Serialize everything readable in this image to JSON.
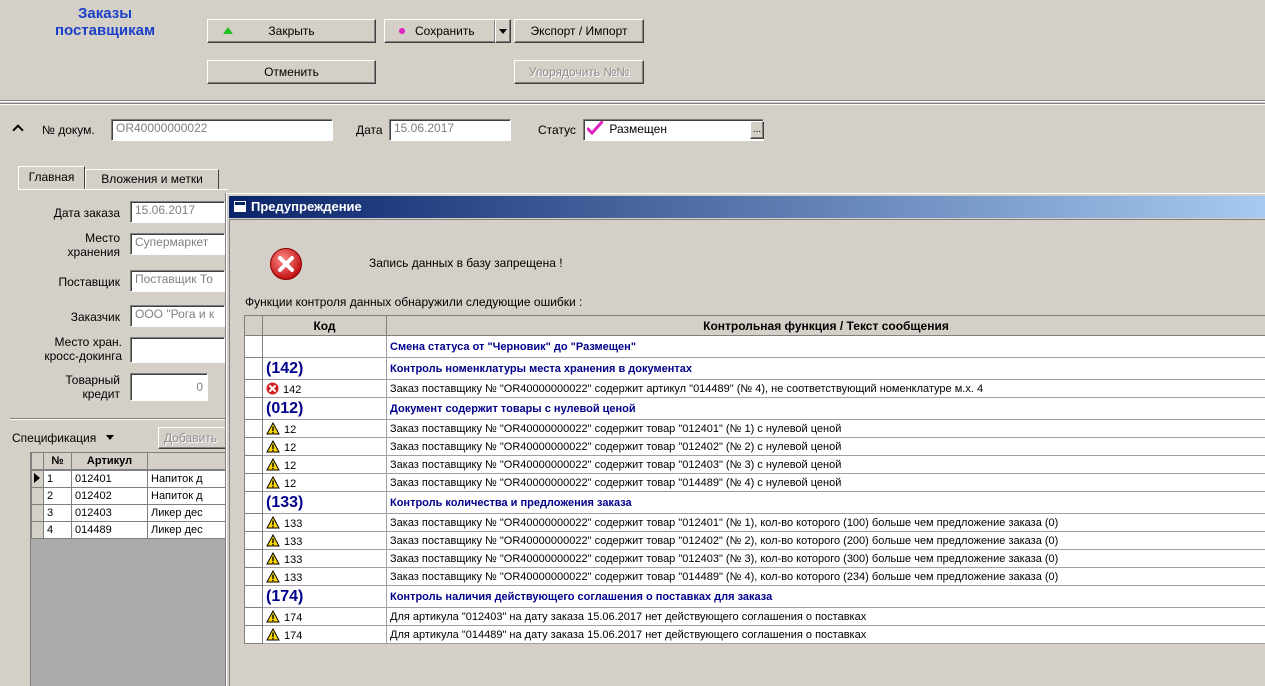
{
  "app": {
    "title_line1": "Заказы",
    "title_line2": "поставщикам"
  },
  "toolbar": {
    "close_label": "Закрыть",
    "save_label": "Сохранить",
    "export_import_label": "Экспорт / Импорт",
    "cancel_label": "Отменить",
    "order_numbers_label": "Упорядочить №№"
  },
  "header": {
    "doc_number_label": "№ докум.",
    "doc_number_value": "OR40000000022",
    "date_label": "Дата",
    "date_value": "15.06.2017",
    "status_label": "Статус",
    "status_value": "Размещен",
    "status_button": "..."
  },
  "tabs": [
    {
      "label": "Главная"
    },
    {
      "label": "Вложения и метки"
    }
  ],
  "form": {
    "order_date_label": "Дата заказа",
    "order_date_value": "15.06.2017",
    "storage_label_1": "Место",
    "storage_label_2": "хранения",
    "storage_value": "Супермаркет",
    "supplier_label": "Поставщик",
    "supplier_value": "Поставщик То",
    "customer_label": "Заказчик",
    "customer_value": "ООО \"Рога и к",
    "crossdock_label_1": "Место хран.",
    "crossdock_label_2": "кросс-докинга",
    "crossdock_value": "",
    "credit_label_1": "Товарный",
    "credit_label_2": "кредит",
    "credit_value": "0"
  },
  "spec": {
    "dropdown_label": "Спецификация",
    "add_label": "Добавить",
    "columns": [
      "№",
      "Артикул",
      ""
    ],
    "rows": [
      {
        "n": "1",
        "article": "012401",
        "name": "Напиток д"
      },
      {
        "n": "2",
        "article": "012402",
        "name": "Напиток д"
      },
      {
        "n": "3",
        "article": "012403",
        "name": "Ликер дес"
      },
      {
        "n": "4",
        "article": "014489",
        "name": "Ликер дес"
      }
    ]
  },
  "dialog": {
    "title": "Предупреждение",
    "main_message": "Запись данных в базу запрещена !",
    "sub_message": "Функции контроля данных обнаружили следующие ошибки :",
    "col_code": "Код",
    "col_text": "Контрольная функция / Текст сообщения",
    "rows": [
      {
        "kind": "group",
        "code": "",
        "text": "Смена статуса от \"Черновик\" до \"Размещен\""
      },
      {
        "kind": "group",
        "code": "(142)",
        "text": "Контроль номенклатуры места хранения в документах"
      },
      {
        "kind": "error",
        "code": "142",
        "text": "Заказ поставщику № \"OR40000000022\" содержит артикул \"014489\" (№ 4), не соответствующий номенклатуре м.х. 4"
      },
      {
        "kind": "group",
        "code": "(012)",
        "text": "Документ содержит товары с нулевой ценой"
      },
      {
        "kind": "warn",
        "code": "12",
        "text": "Заказ поставщику № \"OR40000000022\" содержит товар \"012401\" (№ 1) с нулевой ценой"
      },
      {
        "kind": "warn",
        "code": "12",
        "text": "Заказ поставщику № \"OR40000000022\" содержит товар \"012402\" (№ 2) с нулевой ценой"
      },
      {
        "kind": "warn",
        "code": "12",
        "text": "Заказ поставщику № \"OR40000000022\" содержит товар \"012403\" (№ 3) с нулевой ценой"
      },
      {
        "kind": "warn",
        "code": "12",
        "text": "Заказ поставщику № \"OR40000000022\" содержит товар \"014489\" (№ 4) с нулевой ценой"
      },
      {
        "kind": "group",
        "code": "(133)",
        "text": "Контроль количества и предложения заказа"
      },
      {
        "kind": "warn",
        "code": "133",
        "text": "Заказ поставщику № \"OR40000000022\" содержит товар \"012401\" (№ 1), кол-во которого (100) больше чем предложение заказа (0)"
      },
      {
        "kind": "warn",
        "code": "133",
        "text": "Заказ поставщику № \"OR40000000022\" содержит товар \"012402\" (№ 2), кол-во которого (200) больше чем предложение заказа (0)"
      },
      {
        "kind": "warn",
        "code": "133",
        "text": "Заказ поставщику № \"OR40000000022\" содержит товар \"012403\" (№ 3), кол-во которого (300) больше чем предложение заказа (0)"
      },
      {
        "kind": "warn",
        "code": "133",
        "text": "Заказ поставщику № \"OR40000000022\" содержит товар \"014489\" (№ 4), кол-во которого (234) больше чем предложение заказа (0)"
      },
      {
        "kind": "group",
        "code": "(174)",
        "text": "Контроль наличия действующего соглашения о поставках для заказа"
      },
      {
        "kind": "warn",
        "code": "174",
        "text": "Для артикула \"012403\" на дату заказа 15.06.2017 нет действующего соглашения о поставках"
      },
      {
        "kind": "warn",
        "code": "174",
        "text": "Для артикула \"014489\" на дату заказа 15.06.2017 нет действующего соглашения о поставках"
      }
    ]
  },
  "colors": {
    "window_bg": "#d4d0c8",
    "title_blue": "#1a3fc8",
    "group_text": "#00008b",
    "dialog_title_from": "#0a246a",
    "dialog_title_to": "#a6caf0",
    "status_check": "#e020c0",
    "save_dot": "#e020c0",
    "close_arrow": "#20c020"
  }
}
